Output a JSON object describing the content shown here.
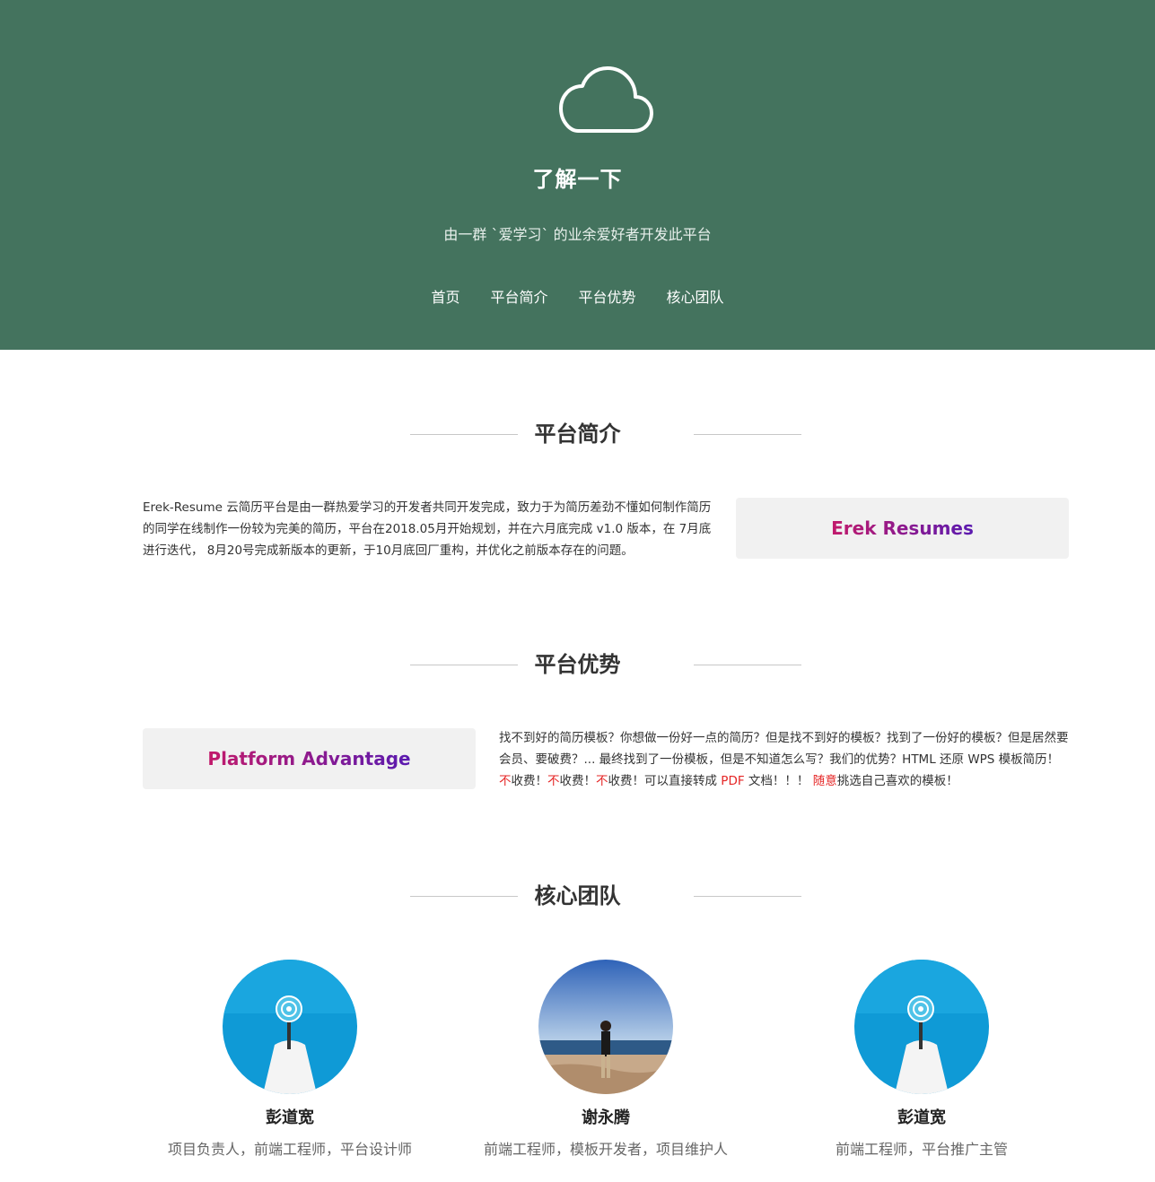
{
  "hero": {
    "icon": "cloud-icon",
    "title": "了解一下",
    "subtitle": "由一群 `爱学习` 的业余爱好者开发此平台",
    "nav": [
      "首页",
      "平台简介",
      "平台优势",
      "核心团队"
    ]
  },
  "intro": {
    "heading": "平台简介",
    "text": "Erek-Resume 云简历平台是由一群热爱学习的开发者共同开发完成，致力于为简历差劲不懂如何制作简历的同学在线制作一份较为完美的简历，平台在2018.05月开始规划，并在六月底完成 v1.0 版本，在 7月底 进行迭代， 8月20号完成新版本的更新，于10月底回厂重构，并优化之前版本存在的问题。",
    "card": "Erek Resumes"
  },
  "advantage": {
    "heading": "平台优势",
    "card": "Platform Advantage",
    "text_parts": [
      "找不到好的简历模板？你想做一份好一点的简历？但是找不到好的模板？找到了一份好的模板？但是居然要会员、要破费？... 最终找到了一份模板，但是不知道怎么写？我们的优势？HTML 还原 WPS 模板简历！",
      "不",
      "收费！",
      "不",
      "收费！",
      "不",
      "收费！可以直接转成 ",
      "PDF",
      " 文档！！！ ",
      "随意",
      "挑选自己喜欢的模板！"
    ]
  },
  "team": {
    "heading": "核心团队",
    "members": [
      {
        "name": "彭道宽",
        "role": "项目负责人，前端工程师，平台设计师"
      },
      {
        "name": "谢永腾",
        "role": "前端工程师，模板开发者，项目维护人"
      },
      {
        "name": "彭道宽",
        "role": "前端工程师，平台推广主管"
      }
    ]
  },
  "colors": {
    "hero_bg": "#44735e",
    "accent_red": "#e52525",
    "card_gradient": [
      "#c21a6b",
      "#5a1ab0"
    ]
  }
}
